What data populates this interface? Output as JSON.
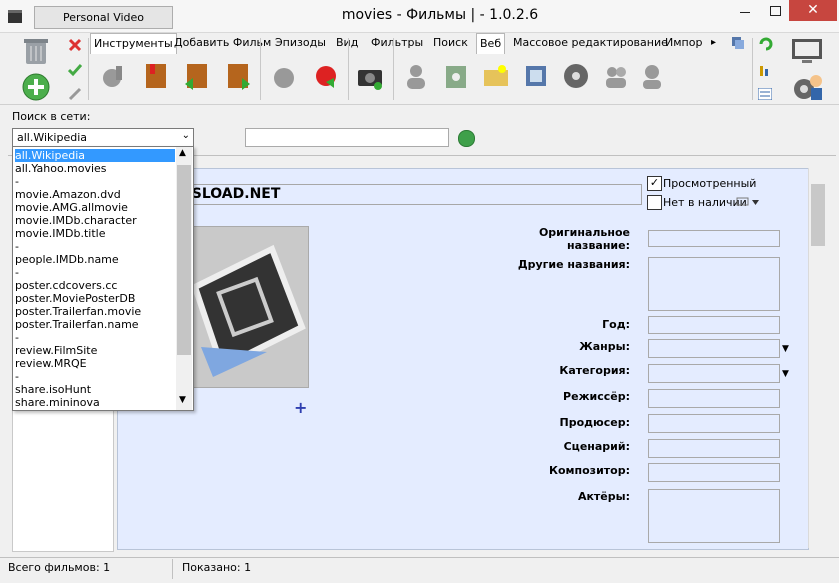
{
  "window": {
    "app_button": "Personal Video Database",
    "title": "movies - Фильмы | - 1.0.2.6",
    "close": "✕"
  },
  "toolbar": {
    "tabs": [
      {
        "label": "Инструменты"
      },
      {
        "label": "Добавить Фильм"
      },
      {
        "label": "Эпизоды"
      },
      {
        "label": "Вид"
      },
      {
        "label": "Фильтры"
      },
      {
        "label": "Поиск"
      },
      {
        "label": "Веб"
      },
      {
        "label": "Массовое редактирование"
      },
      {
        "label": "Импор"
      }
    ],
    "tab_more": "▸",
    "icons": [
      "web-tools-icon",
      "book-import-icon",
      "book-prev-icon",
      "book-next-icon",
      "apple-icon",
      "plug-icon",
      "camera-icon",
      "person-icon",
      "trash-box-icon",
      "folder-icon",
      "movie-download-icon",
      "film-reel-icon",
      "people-icon",
      "person-gray-icon"
    ]
  },
  "search": {
    "label": "Поиск в сети:",
    "selected": "all.Wikipedia",
    "arrow": "⌄",
    "input_value": ""
  },
  "dropdown": {
    "items": [
      "all.Wikipedia",
      "all.Yahoo.movies",
      "-",
      "movie.Amazon.dvd",
      "movie.AMG.allmovie",
      "movie.IMDb.character",
      "movie.IMDb.title",
      "-",
      "people.IMDb.name",
      "-",
      "poster.cdcovers.cc",
      "poster.MoviePosterDB",
      "poster.Trailerfan.movie",
      "poster.Trailerfan.name",
      "-",
      "review.FilmSite",
      "review.MRQE",
      "-",
      "share.isoHunt",
      "share.mininova"
    ],
    "up": "▲",
    "down": "▼"
  },
  "movie": {
    "title": "RSLOAD.NET",
    "add_poster": "+",
    "viewed_check": "✓",
    "viewed_label": "Просмотренный",
    "stock_label": "Нет в наличии",
    "fields": {
      "original_name": "Оригинальное название:",
      "other_names": "Другие названия:",
      "year": "Год:",
      "genres": "Жанры:",
      "category": "Категория:",
      "director": "Режиссёр:",
      "producer": "Продюсер:",
      "screenplay": "Сценарий:",
      "composer": "Композитор:",
      "actors": "Актёры:"
    },
    "select_arrow": "▼"
  },
  "status": {
    "total": "Всего фильмов: 1",
    "shown": "Показано: 1"
  }
}
